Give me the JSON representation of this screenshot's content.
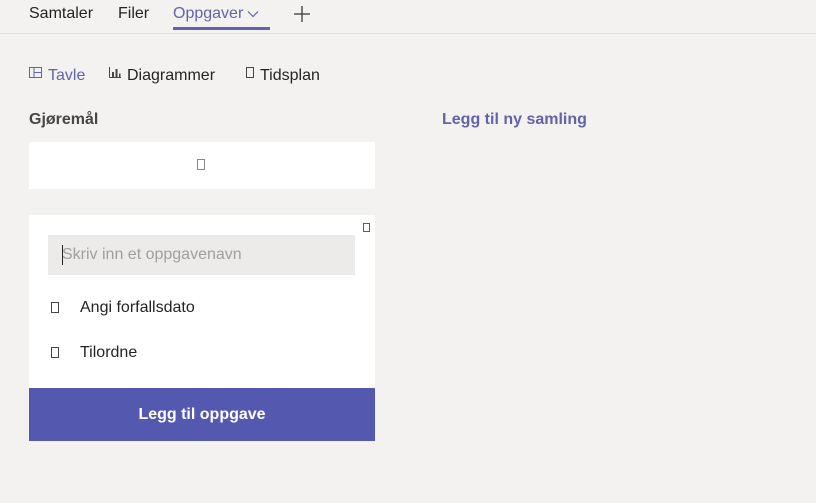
{
  "tabs": {
    "items": [
      {
        "label": "Samtaler"
      },
      {
        "label": "Filer"
      },
      {
        "label": "Oppgaver"
      }
    ],
    "active": "Oppgaver"
  },
  "views": {
    "items": [
      {
        "label": "Tavle",
        "icon": "board-icon"
      },
      {
        "label": "Diagrammer",
        "icon": "chart-icon"
      },
      {
        "label": "Tidsplan",
        "icon": "schedule-icon"
      }
    ],
    "active": "Tavle"
  },
  "bucket": {
    "title": "Gjøremål"
  },
  "add_bucket_label": "Legg til ny samling",
  "new_task": {
    "placeholder": "Skriv inn et oppgavenavn",
    "value": "",
    "due_date_label": "Angi forfallsdato",
    "assign_label": "Tilordne",
    "submit_label": "Legg til oppgave"
  },
  "colors": {
    "accent": "#6264a7",
    "button": "#5558af",
    "background": "#f3f2f1"
  }
}
